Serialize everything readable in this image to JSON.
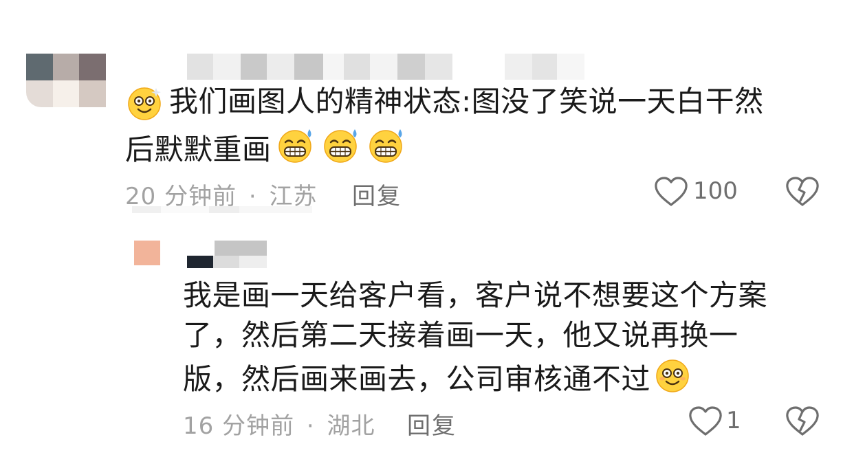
{
  "comments": [
    {
      "text_line1": "我们画图人的精神状态:图没了笑说一天白干然",
      "text_line2": "后默默重画",
      "leading_emoji": "dizzy-smile-emoji",
      "trailing_emojis": [
        "grin-sweat-emoji",
        "grin-sweat-emoji",
        "grin-sweat-emoji"
      ],
      "time": "20 分钟前",
      "location": "江苏",
      "reply_label": "回复",
      "like_count": "100"
    },
    {
      "text_line1": "我是画一天给客户看，客户说不想要这个方案",
      "text_line2": "了，然后第二天接着画一天，他又说再换一",
      "text_line3": "版，然后画来画去，公司审核通不过",
      "trailing_emoji": "dizzy-smile-emoji",
      "time": "16 分钟前",
      "location": "湖北",
      "reply_label": "回复",
      "like_count": "1"
    }
  ],
  "separator": "·",
  "icons": {
    "like": "heart-outline-icon",
    "dislike": "broken-heart-icon"
  },
  "colors": {
    "text": "#1a1a1a",
    "meta": "#a2a2a2",
    "action": "#6e6e6e"
  }
}
